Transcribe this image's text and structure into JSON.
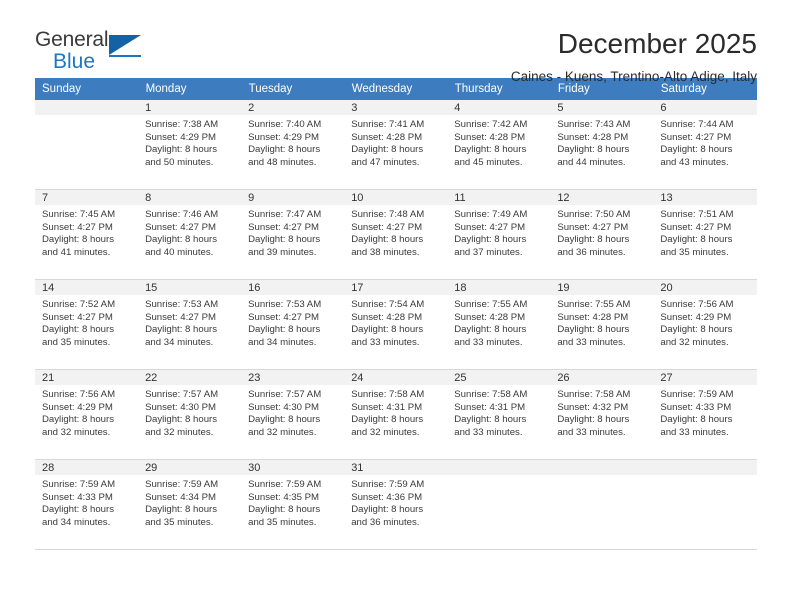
{
  "logo": {
    "word1": "General",
    "word2": "Blue",
    "triangle_color": "#1362a5",
    "blue_color": "#1b77c4"
  },
  "header": {
    "title": "December 2025",
    "subtitle": "Caines - Kuens, Trentino-Alto Adige, Italy"
  },
  "theme": {
    "header_row_bg": "#3d7dbf",
    "daynum_bg": "#f2f2f2",
    "grid_line": "#d8d8d8"
  },
  "weekdays": [
    "Sunday",
    "Monday",
    "Tuesday",
    "Wednesday",
    "Thursday",
    "Friday",
    "Saturday"
  ],
  "labels": {
    "sunrise_prefix": "Sunrise: ",
    "sunset_prefix": "Sunset: ",
    "daylight_prefix": "Daylight: "
  },
  "weeks": [
    [
      {
        "day": "",
        "sunrise": "",
        "sunset": "",
        "daylight_line1": "",
        "daylight_line2": ""
      },
      {
        "day": "1",
        "sunrise": "Sunrise: 7:38 AM",
        "sunset": "Sunset: 4:29 PM",
        "daylight_line1": "Daylight: 8 hours",
        "daylight_line2": "and 50 minutes."
      },
      {
        "day": "2",
        "sunrise": "Sunrise: 7:40 AM",
        "sunset": "Sunset: 4:29 PM",
        "daylight_line1": "Daylight: 8 hours",
        "daylight_line2": "and 48 minutes."
      },
      {
        "day": "3",
        "sunrise": "Sunrise: 7:41 AM",
        "sunset": "Sunset: 4:28 PM",
        "daylight_line1": "Daylight: 8 hours",
        "daylight_line2": "and 47 minutes."
      },
      {
        "day": "4",
        "sunrise": "Sunrise: 7:42 AM",
        "sunset": "Sunset: 4:28 PM",
        "daylight_line1": "Daylight: 8 hours",
        "daylight_line2": "and 45 minutes."
      },
      {
        "day": "5",
        "sunrise": "Sunrise: 7:43 AM",
        "sunset": "Sunset: 4:28 PM",
        "daylight_line1": "Daylight: 8 hours",
        "daylight_line2": "and 44 minutes."
      },
      {
        "day": "6",
        "sunrise": "Sunrise: 7:44 AM",
        "sunset": "Sunset: 4:27 PM",
        "daylight_line1": "Daylight: 8 hours",
        "daylight_line2": "and 43 minutes."
      }
    ],
    [
      {
        "day": "7",
        "sunrise": "Sunrise: 7:45 AM",
        "sunset": "Sunset: 4:27 PM",
        "daylight_line1": "Daylight: 8 hours",
        "daylight_line2": "and 41 minutes."
      },
      {
        "day": "8",
        "sunrise": "Sunrise: 7:46 AM",
        "sunset": "Sunset: 4:27 PM",
        "daylight_line1": "Daylight: 8 hours",
        "daylight_line2": "and 40 minutes."
      },
      {
        "day": "9",
        "sunrise": "Sunrise: 7:47 AM",
        "sunset": "Sunset: 4:27 PM",
        "daylight_line1": "Daylight: 8 hours",
        "daylight_line2": "and 39 minutes."
      },
      {
        "day": "10",
        "sunrise": "Sunrise: 7:48 AM",
        "sunset": "Sunset: 4:27 PM",
        "daylight_line1": "Daylight: 8 hours",
        "daylight_line2": "and 38 minutes."
      },
      {
        "day": "11",
        "sunrise": "Sunrise: 7:49 AM",
        "sunset": "Sunset: 4:27 PM",
        "daylight_line1": "Daylight: 8 hours",
        "daylight_line2": "and 37 minutes."
      },
      {
        "day": "12",
        "sunrise": "Sunrise: 7:50 AM",
        "sunset": "Sunset: 4:27 PM",
        "daylight_line1": "Daylight: 8 hours",
        "daylight_line2": "and 36 minutes."
      },
      {
        "day": "13",
        "sunrise": "Sunrise: 7:51 AM",
        "sunset": "Sunset: 4:27 PM",
        "daylight_line1": "Daylight: 8 hours",
        "daylight_line2": "and 35 minutes."
      }
    ],
    [
      {
        "day": "14",
        "sunrise": "Sunrise: 7:52 AM",
        "sunset": "Sunset: 4:27 PM",
        "daylight_line1": "Daylight: 8 hours",
        "daylight_line2": "and 35 minutes."
      },
      {
        "day": "15",
        "sunrise": "Sunrise: 7:53 AM",
        "sunset": "Sunset: 4:27 PM",
        "daylight_line1": "Daylight: 8 hours",
        "daylight_line2": "and 34 minutes."
      },
      {
        "day": "16",
        "sunrise": "Sunrise: 7:53 AM",
        "sunset": "Sunset: 4:27 PM",
        "daylight_line1": "Daylight: 8 hours",
        "daylight_line2": "and 34 minutes."
      },
      {
        "day": "17",
        "sunrise": "Sunrise: 7:54 AM",
        "sunset": "Sunset: 4:28 PM",
        "daylight_line1": "Daylight: 8 hours",
        "daylight_line2": "and 33 minutes."
      },
      {
        "day": "18",
        "sunrise": "Sunrise: 7:55 AM",
        "sunset": "Sunset: 4:28 PM",
        "daylight_line1": "Daylight: 8 hours",
        "daylight_line2": "and 33 minutes."
      },
      {
        "day": "19",
        "sunrise": "Sunrise: 7:55 AM",
        "sunset": "Sunset: 4:28 PM",
        "daylight_line1": "Daylight: 8 hours",
        "daylight_line2": "and 33 minutes."
      },
      {
        "day": "20",
        "sunrise": "Sunrise: 7:56 AM",
        "sunset": "Sunset: 4:29 PM",
        "daylight_line1": "Daylight: 8 hours",
        "daylight_line2": "and 32 minutes."
      }
    ],
    [
      {
        "day": "21",
        "sunrise": "Sunrise: 7:56 AM",
        "sunset": "Sunset: 4:29 PM",
        "daylight_line1": "Daylight: 8 hours",
        "daylight_line2": "and 32 minutes."
      },
      {
        "day": "22",
        "sunrise": "Sunrise: 7:57 AM",
        "sunset": "Sunset: 4:30 PM",
        "daylight_line1": "Daylight: 8 hours",
        "daylight_line2": "and 32 minutes."
      },
      {
        "day": "23",
        "sunrise": "Sunrise: 7:57 AM",
        "sunset": "Sunset: 4:30 PM",
        "daylight_line1": "Daylight: 8 hours",
        "daylight_line2": "and 32 minutes."
      },
      {
        "day": "24",
        "sunrise": "Sunrise: 7:58 AM",
        "sunset": "Sunset: 4:31 PM",
        "daylight_line1": "Daylight: 8 hours",
        "daylight_line2": "and 32 minutes."
      },
      {
        "day": "25",
        "sunrise": "Sunrise: 7:58 AM",
        "sunset": "Sunset: 4:31 PM",
        "daylight_line1": "Daylight: 8 hours",
        "daylight_line2": "and 33 minutes."
      },
      {
        "day": "26",
        "sunrise": "Sunrise: 7:58 AM",
        "sunset": "Sunset: 4:32 PM",
        "daylight_line1": "Daylight: 8 hours",
        "daylight_line2": "and 33 minutes."
      },
      {
        "day": "27",
        "sunrise": "Sunrise: 7:59 AM",
        "sunset": "Sunset: 4:33 PM",
        "daylight_line1": "Daylight: 8 hours",
        "daylight_line2": "and 33 minutes."
      }
    ],
    [
      {
        "day": "28",
        "sunrise": "Sunrise: 7:59 AM",
        "sunset": "Sunset: 4:33 PM",
        "daylight_line1": "Daylight: 8 hours",
        "daylight_line2": "and 34 minutes."
      },
      {
        "day": "29",
        "sunrise": "Sunrise: 7:59 AM",
        "sunset": "Sunset: 4:34 PM",
        "daylight_line1": "Daylight: 8 hours",
        "daylight_line2": "and 35 minutes."
      },
      {
        "day": "30",
        "sunrise": "Sunrise: 7:59 AM",
        "sunset": "Sunset: 4:35 PM",
        "daylight_line1": "Daylight: 8 hours",
        "daylight_line2": "and 35 minutes."
      },
      {
        "day": "31",
        "sunrise": "Sunrise: 7:59 AM",
        "sunset": "Sunset: 4:36 PM",
        "daylight_line1": "Daylight: 8 hours",
        "daylight_line2": "and 36 minutes."
      },
      {
        "day": "",
        "sunrise": "",
        "sunset": "",
        "daylight_line1": "",
        "daylight_line2": ""
      },
      {
        "day": "",
        "sunrise": "",
        "sunset": "",
        "daylight_line1": "",
        "daylight_line2": ""
      },
      {
        "day": "",
        "sunrise": "",
        "sunset": "",
        "daylight_line1": "",
        "daylight_line2": ""
      }
    ]
  ]
}
